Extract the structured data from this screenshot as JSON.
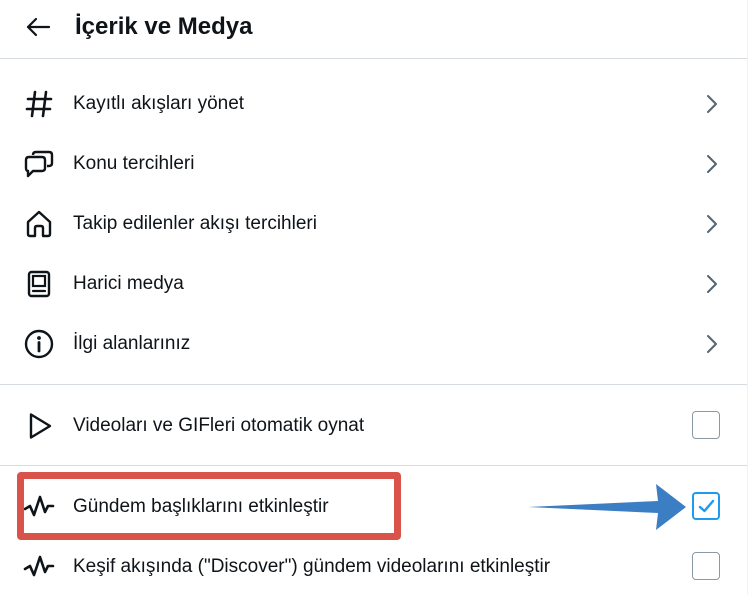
{
  "header": {
    "title": "İçerik ve Medya",
    "back_icon": "arrow-left-icon"
  },
  "nav_items": [
    {
      "label": "Kayıtlı akışları yönet",
      "icon": "hashtag-icon"
    },
    {
      "label": "Konu tercihleri",
      "icon": "chat-bubbles-icon"
    },
    {
      "label": "Takip edilenler akışı tercihleri",
      "icon": "home-icon"
    },
    {
      "label": "Harici medya",
      "icon": "media-card-icon"
    },
    {
      "label": "İlgi alanlarınız",
      "icon": "info-icon"
    }
  ],
  "toggles": [
    {
      "label": "Videoları ve GIFleri otomatik oynat",
      "icon": "play-icon",
      "checked": false
    },
    {
      "label": "Gündem başlıklarını etkinleştir",
      "icon": "trending-wave-icon",
      "checked": true
    },
    {
      "label": "Keşif akışında (\"Discover\") gündem videolarını etkinleştir",
      "icon": "trending-wave-icon",
      "checked": false
    }
  ],
  "annotation": {
    "highlight_color": "#d9534a",
    "arrow_color": "#3b7ec4"
  },
  "colors": {
    "accent": "#1d9bf0",
    "text": "#0f1419",
    "chevron": "#536471",
    "divider": "#d6dbdf"
  }
}
